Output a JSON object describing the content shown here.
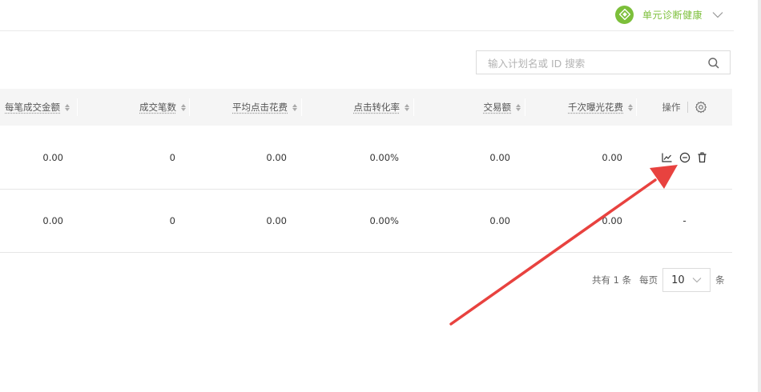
{
  "diagnosis": {
    "label": "单元诊断健康",
    "icon": "health-diamond-icon",
    "color": "#7cbf3a"
  },
  "search": {
    "placeholder": "输入计划名或 ID 搜索",
    "value": "",
    "icon": "search-icon"
  },
  "table": {
    "columns": [
      "每笔成交金额",
      "成交笔数",
      "平均点击花费",
      "点击转化率",
      "交易额",
      "千次曝光花费"
    ],
    "ops_header": "操作",
    "ops_settings_icon": "gear-icon",
    "rows": [
      {
        "cells": [
          "0.00",
          "0",
          "0.00",
          "0.00%",
          "0.00",
          "0.00"
        ],
        "actions": [
          "chart-icon",
          "minus-circle-icon",
          "trash-icon"
        ]
      },
      {
        "cells": [
          "0.00",
          "0",
          "0.00",
          "0.00%",
          "0.00",
          "0.00"
        ],
        "ops_text": "-"
      }
    ]
  },
  "pagination": {
    "total": "共有 1 条",
    "per_page_label": "每页",
    "per_page_value": "10",
    "unit": "条"
  },
  "annotation": {
    "type": "red-arrow",
    "color": "#e8423f",
    "points_to": "delete-button"
  }
}
